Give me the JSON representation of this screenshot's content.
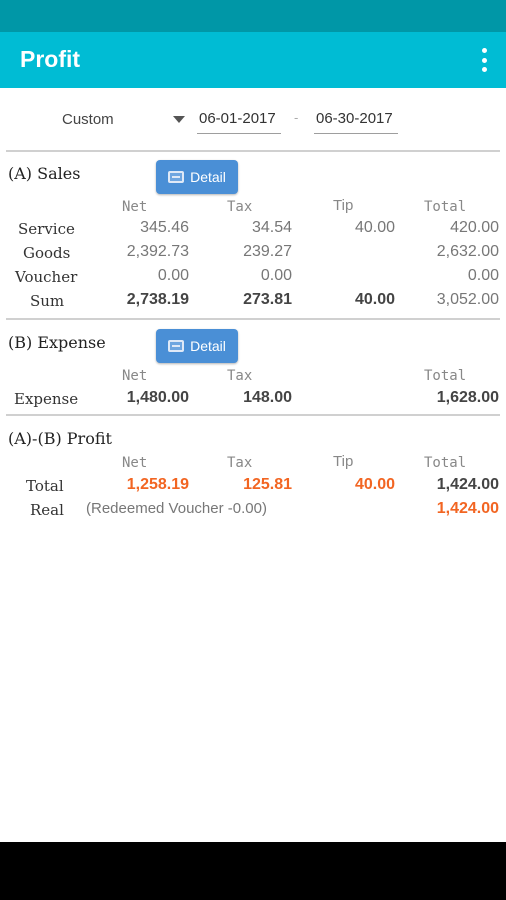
{
  "app": {
    "title": "Profit"
  },
  "filter": {
    "range": "Custom",
    "from_date": "06-01-2017",
    "separator": "-",
    "to_date": "06-30-2017"
  },
  "columns": {
    "net": "Net",
    "tax": "Tax",
    "tip": "Tip",
    "total": "Total"
  },
  "sales": {
    "title": "(A) Sales",
    "detail_label": "Detail",
    "rows": [
      {
        "label": "Service",
        "net": "345.46",
        "tax": "34.54",
        "tip": "40.00",
        "total": "420.00"
      },
      {
        "label": "Goods",
        "net": "2,392.73",
        "tax": "239.27",
        "tip": "",
        "total": "2,632.00"
      },
      {
        "label": "Voucher",
        "net": "0.00",
        "tax": "0.00",
        "tip": "",
        "total": "0.00"
      },
      {
        "label": "Sum",
        "net": "2,738.19",
        "tax": "273.81",
        "tip": "40.00",
        "total": "3,052.00"
      }
    ]
  },
  "expense": {
    "title": "(B) Expense",
    "detail_label": "Detail",
    "rows": [
      {
        "label": "Expense",
        "net": "1,480.00",
        "tax": "148.00",
        "total": "1,628.00"
      }
    ]
  },
  "profit": {
    "title": "(A)-(B) Profit",
    "total": {
      "label": "Total",
      "net": "1,258.19",
      "tax": "125.81",
      "tip": "40.00",
      "total": "1,424.00"
    },
    "real": {
      "label": "Real",
      "note": "(Redeemed Voucher -0.00)",
      "total": "1,424.00"
    }
  },
  "colors": {
    "status_bar": "#0097a7",
    "app_bar": "#00bcd4",
    "button": "#4a8fd6",
    "highlight": "#f26522"
  }
}
